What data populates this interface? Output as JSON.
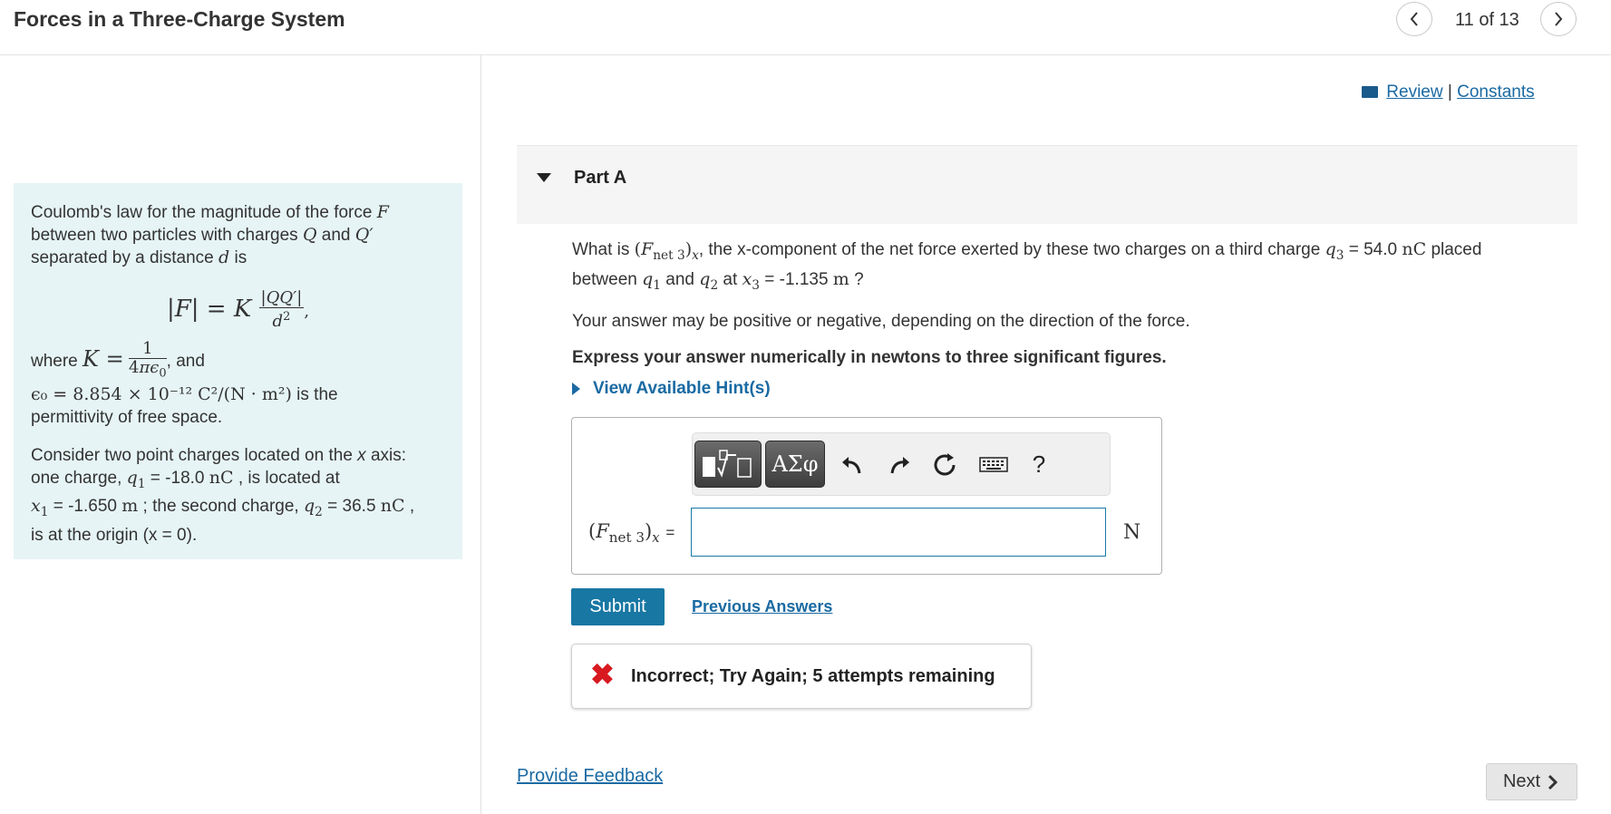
{
  "header": {
    "title": "Forces in a Three-Charge System",
    "prev_icon": "chevron-left-icon",
    "next_icon": "chevron-right-icon",
    "pager": "11 of 13"
  },
  "links": {
    "review": "Review",
    "separator": "|",
    "constants": "Constants"
  },
  "intro": {
    "p1_a": "Coulomb's law for the magnitude of the force",
    "p1_b": "between two particles with charges",
    "p1_c": "and",
    "p1_d": "separated by a distance",
    "p1_e": "is",
    "where": "where",
    "and": ", and",
    "epsilon_value": "ϵ₀ = 8.854 × 10⁻¹² C²/(N · m²)",
    "is_the": "is the",
    "permittivity": "permittivity of free space.",
    "p3_a": "Consider two point charges located on the",
    "x_axis": "x",
    "p3_b": "axis:",
    "p3_c": "one charge,",
    "q1_val": "= -18.0",
    "nC": "nC",
    "p3_d": ", is located at",
    "x1_val": "= -1.650",
    "m": "m",
    "p3_e": "; the second charge,",
    "q2_val": "= 36.5",
    "p3_f": ",",
    "p3_g": "is at the origin",
    "origin": "(x = 0)."
  },
  "part": {
    "label": "Part A"
  },
  "question": {
    "q_a": "What is",
    "q_b": ", the x-component of the net force exerted by these two charges on a third charge",
    "q3_val": "= 54.0",
    "placed": "placed",
    "q_c": "between",
    "and": "and",
    "at": "at",
    "x3_val": "= -1.135",
    "q_end": "?",
    "line2": "Your answer may be positive or negative, depending on the direction of the force.",
    "line3": "Express your answer numerically in newtons to three significant figures."
  },
  "hint": {
    "label": "View Available Hint(s)"
  },
  "toolbar": {
    "greek_label": "ΑΣφ",
    "help_label": "?"
  },
  "answer": {
    "label_eq": "=",
    "value": "",
    "unit": "N"
  },
  "actions": {
    "submit": "Submit",
    "previous_answers": "Previous Answers",
    "feedback": "Incorrect; Try Again; 5 attempts remaining",
    "provide_feedback": "Provide Feedback",
    "next": "Next"
  },
  "colors": {
    "accent": "#1877a3",
    "link": "#1a6aa3",
    "error": "#d81920",
    "intro_bg": "#e6f4f5"
  }
}
